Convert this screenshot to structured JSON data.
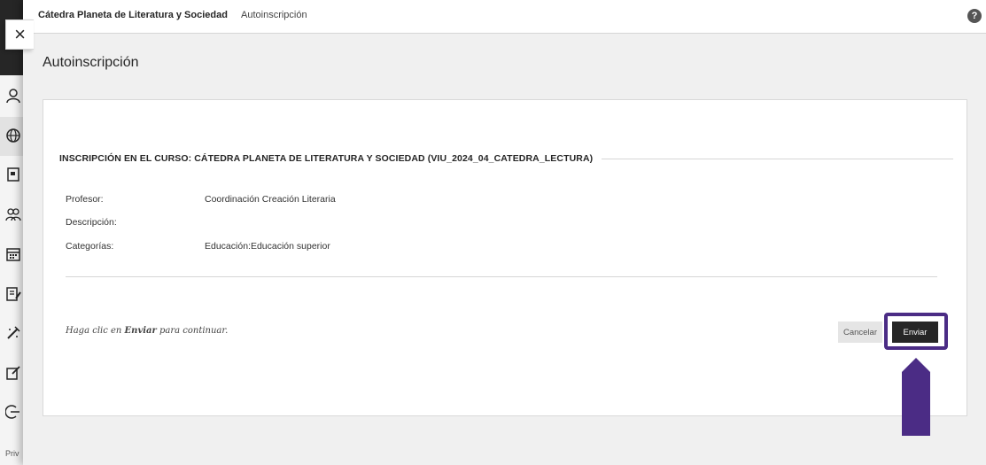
{
  "breadcrumb": {
    "course": "Cátedra Planeta de Literatura y Sociedad",
    "page": "Autoinscripción"
  },
  "page_title": "Autoinscripción",
  "enroll": {
    "section_title": "INSCRIPCIÓN EN EL CURSO: CÁTEDRA PLANETA DE LITERATURA Y SOCIEDAD (VIU_2024_04_CATEDRA_LECTURA)",
    "rows": [
      {
        "label": "Profesor:",
        "value": "Coordinación Creación Literaria"
      },
      {
        "label": "Descripción:",
        "value": ""
      },
      {
        "label": "Categorías:",
        "value": "Educación:Educación superior"
      }
    ],
    "instruction_prefix": "Haga clic en ",
    "instruction_bold": "Enviar",
    "instruction_suffix": " para continuar.",
    "cancel_label": "Cancelar",
    "submit_label": "Enviar"
  },
  "help_glyph": "?",
  "close_glyph": "×",
  "rail": {
    "privacy_text": "Priv",
    "icons": [
      "profile-icon",
      "globe-icon",
      "courses-icon",
      "groups-icon",
      "calendar-icon",
      "grades-icon",
      "tools-icon",
      "edit-icon",
      "sign-out-icon"
    ]
  },
  "colors": {
    "highlight": "#4b2c85",
    "submit_bg": "#262626",
    "cancel_bg": "#e5e5e5"
  }
}
